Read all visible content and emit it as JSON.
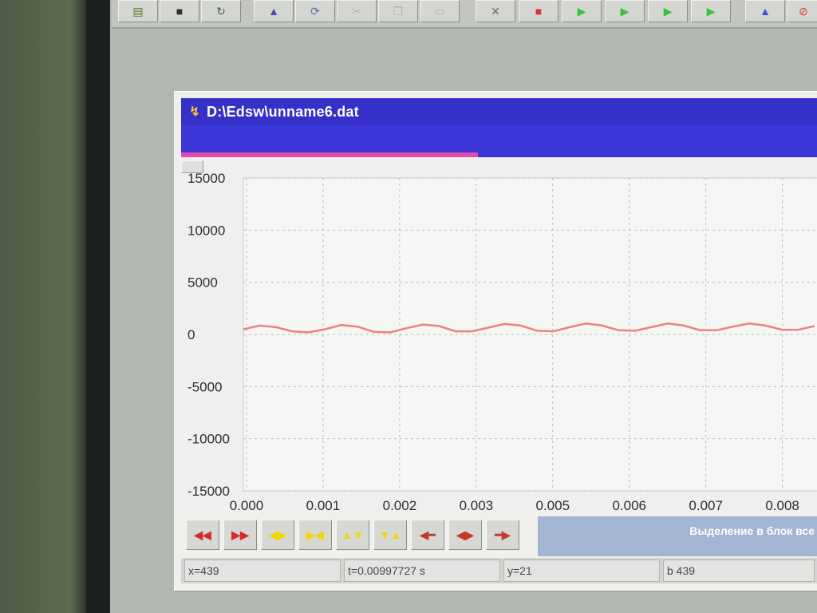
{
  "window": {
    "title": "D:\\Edsw\\unname6.dat",
    "hint_text": "Выделение в блок все"
  },
  "toolbar": {
    "buttons": [
      {
        "name": "open-folder-icon",
        "glyph": "▤",
        "color": "#5a7a2a"
      },
      {
        "name": "save-disk-icon",
        "glyph": "■",
        "color": "#2d2d2d"
      },
      {
        "name": "refresh-icon",
        "glyph": "↻",
        "color": "#3d6a3d"
      },
      {
        "name": "signal-peak-icon",
        "glyph": "▲",
        "color": "#4a4ab0"
      },
      {
        "name": "sync-icon",
        "glyph": "⟳",
        "color": "#6a6ab0"
      },
      {
        "name": "cut-icon",
        "glyph": "✂",
        "color": "#b0b0b0"
      },
      {
        "name": "copy-icon",
        "glyph": "❐",
        "color": "#b0b0b0"
      },
      {
        "name": "paste-icon",
        "glyph": "▭",
        "color": "#b0b0b0"
      },
      {
        "name": "measure-icon",
        "glyph": "✕",
        "color": "#6a6a6a"
      },
      {
        "name": "stop-icon",
        "glyph": "■",
        "color": "#d83030"
      },
      {
        "name": "play-icon",
        "glyph": "▶",
        "color": "#39c439"
      },
      {
        "name": "record-icon",
        "glyph": "▶",
        "color": "#39c439"
      },
      {
        "name": "step-icon",
        "glyph": "▶",
        "color": "#39c439"
      },
      {
        "name": "fast-forward-icon",
        "glyph": "▶",
        "color": "#39c439"
      },
      {
        "name": "spectrum-icon",
        "glyph": "▲",
        "color": "#3a5ad0"
      },
      {
        "name": "no-entry-icon",
        "glyph": "⊘",
        "color": "#d83030"
      }
    ]
  },
  "controls": [
    {
      "name": "scroll-left-fast-icon",
      "glyph": "◀◀",
      "color": "#d62a2a"
    },
    {
      "name": "scroll-right-fast-icon",
      "glyph": "▶▶",
      "color": "#d62a2a"
    },
    {
      "name": "zoom-in-horizontal-icon",
      "glyph": "◀▶",
      "color": "#f2d40b"
    },
    {
      "name": "zoom-out-horizontal-icon",
      "glyph": "▶◀",
      "color": "#f2d40b"
    },
    {
      "name": "zoom-in-vertical-icon",
      "glyph": "▲▼",
      "color": "#f2d40b"
    },
    {
      "name": "zoom-out-vertical-icon",
      "glyph": "▼▲",
      "color": "#f2d40b"
    },
    {
      "name": "shift-left-icon",
      "glyph": "◀━",
      "color": "#c43a2a"
    },
    {
      "name": "fit-icon",
      "glyph": "◀▶",
      "color": "#c43a2a"
    },
    {
      "name": "shift-right-icon",
      "glyph": "━▶",
      "color": "#c43a2a"
    }
  ],
  "status": {
    "x": "x=439",
    "t": "t=0.00997727 s",
    "y": "y=21",
    "b": "b 439"
  },
  "chart_data": {
    "type": "line",
    "ylim": [
      -15000,
      15000
    ],
    "xlim": [
      0,
      0.0088
    ],
    "y_ticks": [
      "15000",
      "10000",
      "5000",
      "0",
      "-5000",
      "-10000",
      "-15000"
    ],
    "y_tick_values": [
      15000,
      10000,
      5000,
      0,
      -5000,
      -10000,
      -15000
    ],
    "x_ticks": [
      "0.000",
      "0.001",
      "0.002",
      "0.003",
      "0.005",
      "0.006",
      "0.007",
      "0.008"
    ],
    "x_tick_values": [
      0,
      0.001,
      0.002,
      0.003,
      0.004,
      0.005,
      0.006,
      0.007
    ],
    "grid": true,
    "series": [
      {
        "color": "#f07f7f",
        "x": [
          0,
          0.00025,
          0.0005,
          0.00075,
          0.001,
          0.00125,
          0.0015,
          0.00175,
          0.002,
          0.00225,
          0.0025,
          0.00275,
          0.003,
          0.00325,
          0.0035,
          0.00375,
          0.004,
          0.00425,
          0.0045,
          0.00475,
          0.005,
          0.00525,
          0.0055,
          0.00575,
          0.006,
          0.00625,
          0.0065,
          0.00675,
          0.007,
          0.00725,
          0.0075,
          0.00775,
          0.008,
          0.00825,
          0.0085,
          0.00875
        ],
        "y": [
          500,
          850,
          700,
          300,
          200,
          500,
          900,
          750,
          250,
          200,
          600,
          950,
          800,
          300,
          300,
          650,
          1000,
          850,
          350,
          300,
          700,
          1050,
          850,
          400,
          350,
          700,
          1050,
          850,
          400,
          400,
          750,
          1050,
          850,
          450,
          450,
          800
        ]
      }
    ]
  }
}
